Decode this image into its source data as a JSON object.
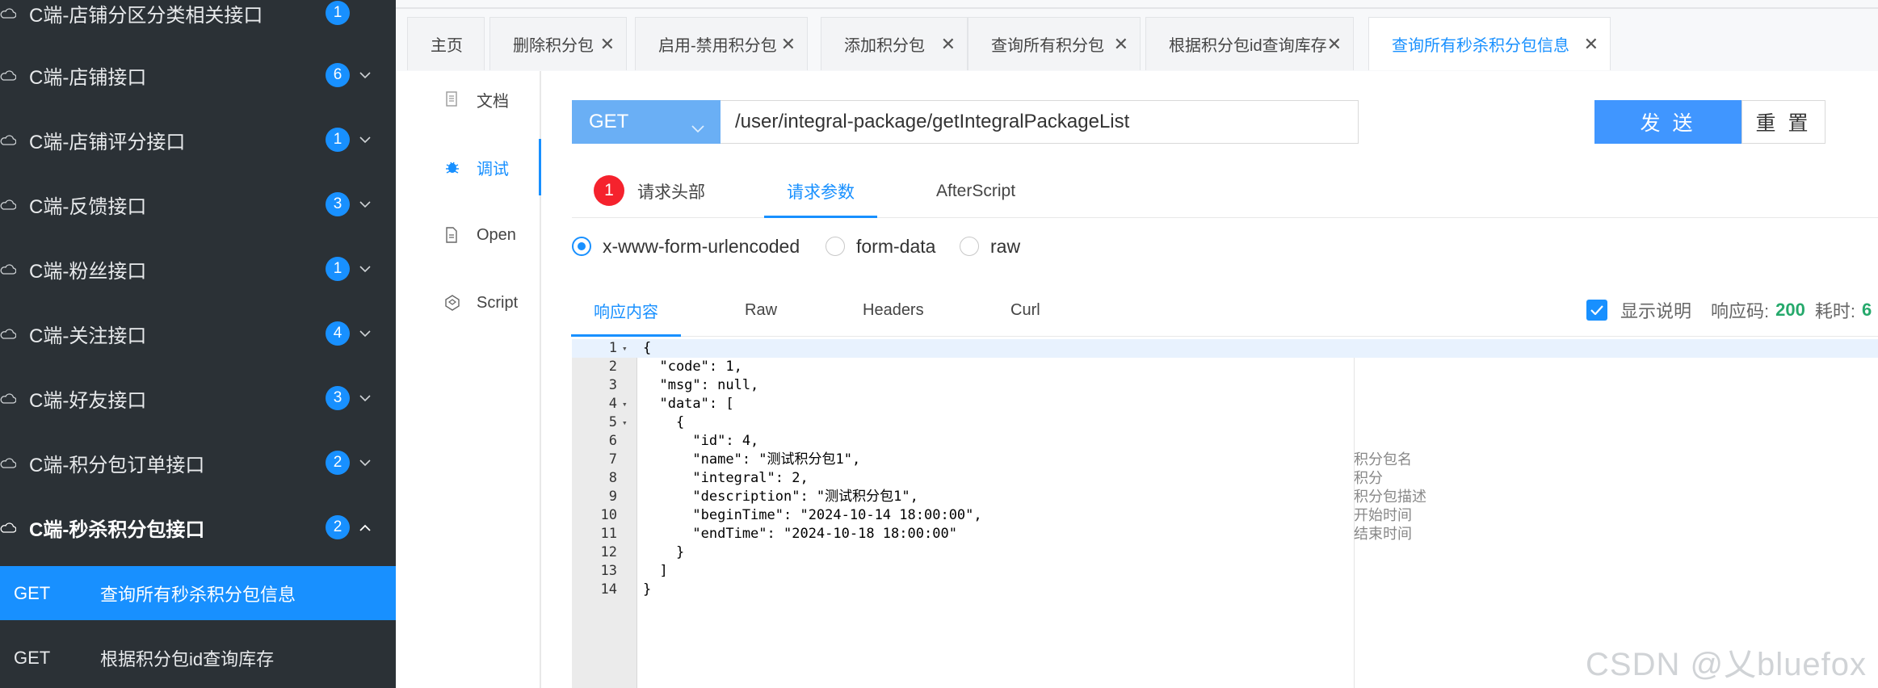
{
  "sidebar": {
    "top_partial": {
      "label": "C端-店铺分区分类相关接口",
      "count": "1"
    },
    "groups": [
      {
        "label": "C端-店铺接口",
        "count": "6"
      },
      {
        "label": "C端-店铺评分接口",
        "count": "1"
      },
      {
        "label": "C端-反馈接口",
        "count": "3"
      },
      {
        "label": "C端-粉丝接口",
        "count": "1"
      },
      {
        "label": "C端-关注接口",
        "count": "4"
      },
      {
        "label": "C端-好友接口",
        "count": "3"
      },
      {
        "label": "C端-积分包订单接口",
        "count": "2"
      },
      {
        "label": "C端-秒杀积分包接口",
        "count": "2"
      }
    ],
    "sub_items": [
      {
        "method": "GET",
        "name": "查询所有秒杀积分包信息"
      },
      {
        "method": "GET",
        "name": "根据积分包id查询库存"
      }
    ]
  },
  "tabs": [
    {
      "label": "主页"
    },
    {
      "label": "删除积分包"
    },
    {
      "label": "启用-禁用积分包"
    },
    {
      "label": "添加积分包"
    },
    {
      "label": "查询所有积分包"
    },
    {
      "label": "根据积分包id查询库存"
    },
    {
      "label": "查询所有秒杀积分包信息"
    }
  ],
  "vnav": [
    {
      "label": "文档",
      "icon": "document-icon"
    },
    {
      "label": "调试",
      "icon": "bug-icon"
    },
    {
      "label": "Open",
      "icon": "file-icon"
    },
    {
      "label": "Script",
      "icon": "code-icon"
    }
  ],
  "request": {
    "method": "GET",
    "url": "/user/integral-package/getIntegralPackageList",
    "send_label": "发 送",
    "reset_label": "重 置"
  },
  "req_tabs": {
    "headers_badge": "1",
    "headers": "请求头部",
    "params": "请求参数",
    "afterscript": "AfterScript"
  },
  "content_types": [
    "x-www-form-urlencoded",
    "form-data",
    "raw"
  ],
  "resp_tabs": [
    "响应内容",
    "Raw",
    "Headers",
    "Curl"
  ],
  "resp_meta": {
    "show_desc": "显示说明",
    "code_label": "响应码:",
    "code_value": "200",
    "time_label": "耗时:",
    "time_value": "6"
  },
  "code_lines": [
    {
      "n": "1",
      "fold": "▾",
      "text": "{"
    },
    {
      "n": "2",
      "fold": "",
      "text": "  \"code\": 1,"
    },
    {
      "n": "3",
      "fold": "",
      "text": "  \"msg\": null,"
    },
    {
      "n": "4",
      "fold": "▾",
      "text": "  \"data\": ["
    },
    {
      "n": "5",
      "fold": "▾",
      "text": "    {"
    },
    {
      "n": "6",
      "fold": "",
      "text": "      \"id\": 4,"
    },
    {
      "n": "7",
      "fold": "",
      "text": "      \"name\": \"测试积分包1\","
    },
    {
      "n": "8",
      "fold": "",
      "text": "      \"integral\": 2,"
    },
    {
      "n": "9",
      "fold": "",
      "text": "      \"description\": \"测试积分包1\","
    },
    {
      "n": "10",
      "fold": "",
      "text": "      \"beginTime\": \"2024-10-14 18:00:00\","
    },
    {
      "n": "11",
      "fold": "",
      "text": "      \"endTime\": \"2024-10-18 18:00:00\""
    },
    {
      "n": "12",
      "fold": "",
      "text": "    }"
    },
    {
      "n": "13",
      "fold": "",
      "text": "  ]"
    },
    {
      "n": "14",
      "fold": "",
      "text": "}"
    }
  ],
  "field_descriptions": [
    "积分包名",
    "积分",
    "积分包描述",
    "开始时间",
    "结束时间"
  ],
  "watermark": "CSDN @乂bluefox",
  "colors": {
    "accent": "#1890ff",
    "sidebar_bg": "#2b3136",
    "badge_error": "#f5222d",
    "status_ok": "#26a96c"
  }
}
